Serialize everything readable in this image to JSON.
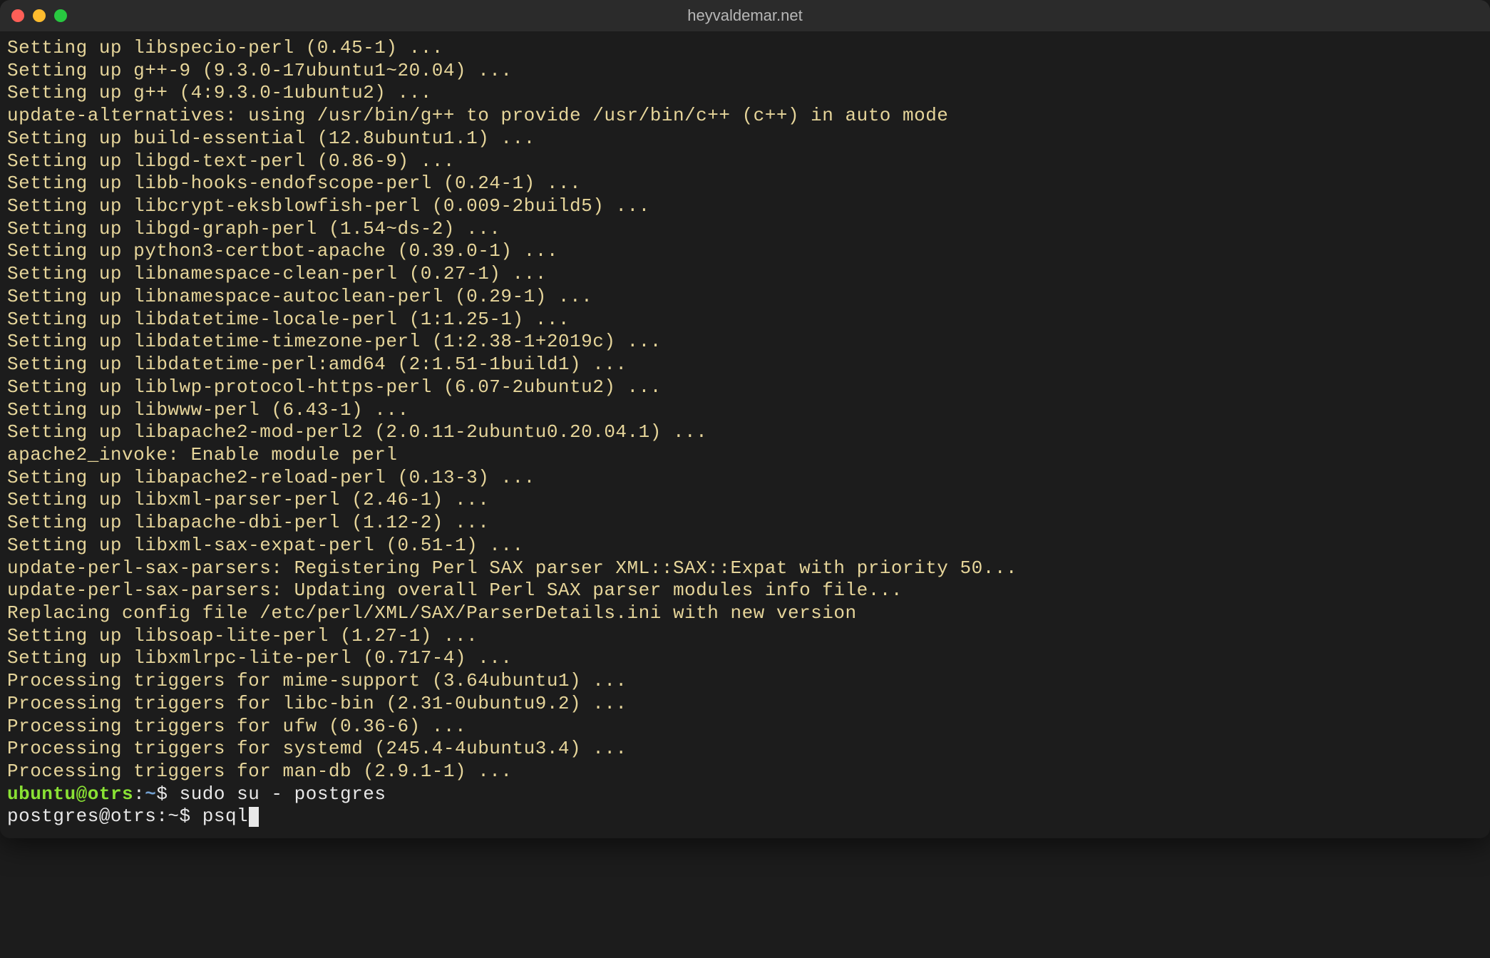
{
  "window": {
    "title": "heyvaldemar.net"
  },
  "output_lines": [
    "Setting up libspecio-perl (0.45-1) ...",
    "Setting up g++-9 (9.3.0-17ubuntu1~20.04) ...",
    "Setting up g++ (4:9.3.0-1ubuntu2) ...",
    "update-alternatives: using /usr/bin/g++ to provide /usr/bin/c++ (c++) in auto mode",
    "Setting up build-essential (12.8ubuntu1.1) ...",
    "Setting up libgd-text-perl (0.86-9) ...",
    "Setting up libb-hooks-endofscope-perl (0.24-1) ...",
    "Setting up libcrypt-eksblowfish-perl (0.009-2build5) ...",
    "Setting up libgd-graph-perl (1.54~ds-2) ...",
    "Setting up python3-certbot-apache (0.39.0-1) ...",
    "Setting up libnamespace-clean-perl (0.27-1) ...",
    "Setting up libnamespace-autoclean-perl (0.29-1) ...",
    "Setting up libdatetime-locale-perl (1:1.25-1) ...",
    "Setting up libdatetime-timezone-perl (1:2.38-1+2019c) ...",
    "Setting up libdatetime-perl:amd64 (2:1.51-1build1) ...",
    "Setting up liblwp-protocol-https-perl (6.07-2ubuntu2) ...",
    "Setting up libwww-perl (6.43-1) ...",
    "Setting up libapache2-mod-perl2 (2.0.11-2ubuntu0.20.04.1) ...",
    "apache2_invoke: Enable module perl",
    "Setting up libapache2-reload-perl (0.13-3) ...",
    "Setting up libxml-parser-perl (2.46-1) ...",
    "Setting up libapache-dbi-perl (1.12-2) ...",
    "Setting up libxml-sax-expat-perl (0.51-1) ...",
    "update-perl-sax-parsers: Registering Perl SAX parser XML::SAX::Expat with priority 50...",
    "update-perl-sax-parsers: Updating overall Perl SAX parser modules info file...",
    "Replacing config file /etc/perl/XML/SAX/ParserDetails.ini with new version",
    "Setting up libsoap-lite-perl (1.27-1) ...",
    "Setting up libxmlrpc-lite-perl (0.717-4) ...",
    "Processing triggers for mime-support (3.64ubuntu1) ...",
    "Processing triggers for libc-bin (2.31-0ubuntu9.2) ...",
    "Processing triggers for ufw (0.36-6) ...",
    "Processing triggers for systemd (245.4-4ubuntu3.4) ...",
    "Processing triggers for man-db (2.9.1-1) ..."
  ],
  "prompt1": {
    "user": "ubuntu",
    "at": "@",
    "host": "otrs",
    "colon": ":",
    "path": "~",
    "symbol": "$ ",
    "command": "sudo su - postgres"
  },
  "prompt2": {
    "text": "postgres@otrs:~$ ",
    "command": "psql"
  }
}
